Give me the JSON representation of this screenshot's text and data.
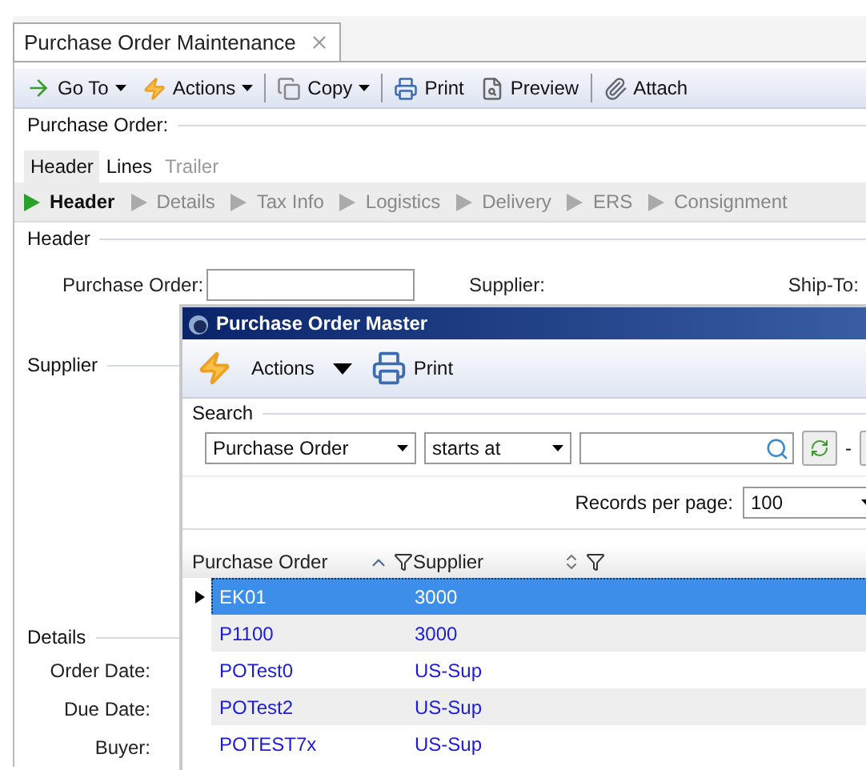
{
  "document_tab": {
    "title": "Purchase Order Maintenance"
  },
  "toolbar": [
    {
      "label": "Go To",
      "caret": true
    },
    {
      "label": "Actions",
      "caret": true
    },
    {
      "label": "Copy",
      "caret": true
    },
    {
      "label": "Print",
      "caret": false
    },
    {
      "label": "Preview",
      "caret": false
    },
    {
      "label": "Attach",
      "caret": false
    }
  ],
  "purchase_order_group": {
    "label": "Purchase Order:"
  },
  "tabs": [
    {
      "label": "Header",
      "selected": true,
      "disabled": false
    },
    {
      "label": "Lines",
      "selected": false,
      "disabled": false
    },
    {
      "label": "Trailer",
      "selected": false,
      "disabled": true
    }
  ],
  "steps": [
    {
      "label": "Header",
      "active": true
    },
    {
      "label": "Details",
      "active": false
    },
    {
      "label": "Tax Info",
      "active": false
    },
    {
      "label": "Logistics",
      "active": false
    },
    {
      "label": "Delivery",
      "active": false
    },
    {
      "label": "ERS",
      "active": false
    },
    {
      "label": "Consignment",
      "active": false
    }
  ],
  "header_group": {
    "label": "Header",
    "fields": [
      {
        "label": "Purchase Order:",
        "kind": "input"
      },
      {
        "label": "Supplier:",
        "kind": "label"
      },
      {
        "label": "Ship-To:",
        "kind": "label"
      }
    ]
  },
  "supplier_group": {
    "label": "Supplier"
  },
  "details_group": {
    "label": "Details",
    "fields": [
      "Order Date:",
      "Due Date:",
      "Buyer:"
    ]
  },
  "popup": {
    "title": "Purchase Order Master",
    "toolbar": [
      {
        "label": "Actions",
        "caret": true
      },
      {
        "label": "Print",
        "caret": false
      }
    ],
    "search": {
      "label": "Search",
      "field": "Purchase Order",
      "operator": "starts at",
      "separator": "-"
    },
    "records_per_page": {
      "label": "Records per page:",
      "value": "100"
    },
    "columns": [
      {
        "label": "Purchase Order",
        "sorted": true
      },
      {
        "label": "Supplier",
        "sorted": false
      }
    ],
    "rows": [
      {
        "cells": [
          "EK01",
          "3000"
        ],
        "selected": true
      },
      {
        "cells": [
          "P1100",
          "3000"
        ],
        "selected": false
      },
      {
        "cells": [
          "POTest0",
          "US-Sup"
        ],
        "selected": false
      },
      {
        "cells": [
          "POTest2",
          "US-Sup"
        ],
        "selected": false
      },
      {
        "cells": [
          "POTEST7x",
          "US-Sup"
        ],
        "selected": false
      }
    ]
  }
}
